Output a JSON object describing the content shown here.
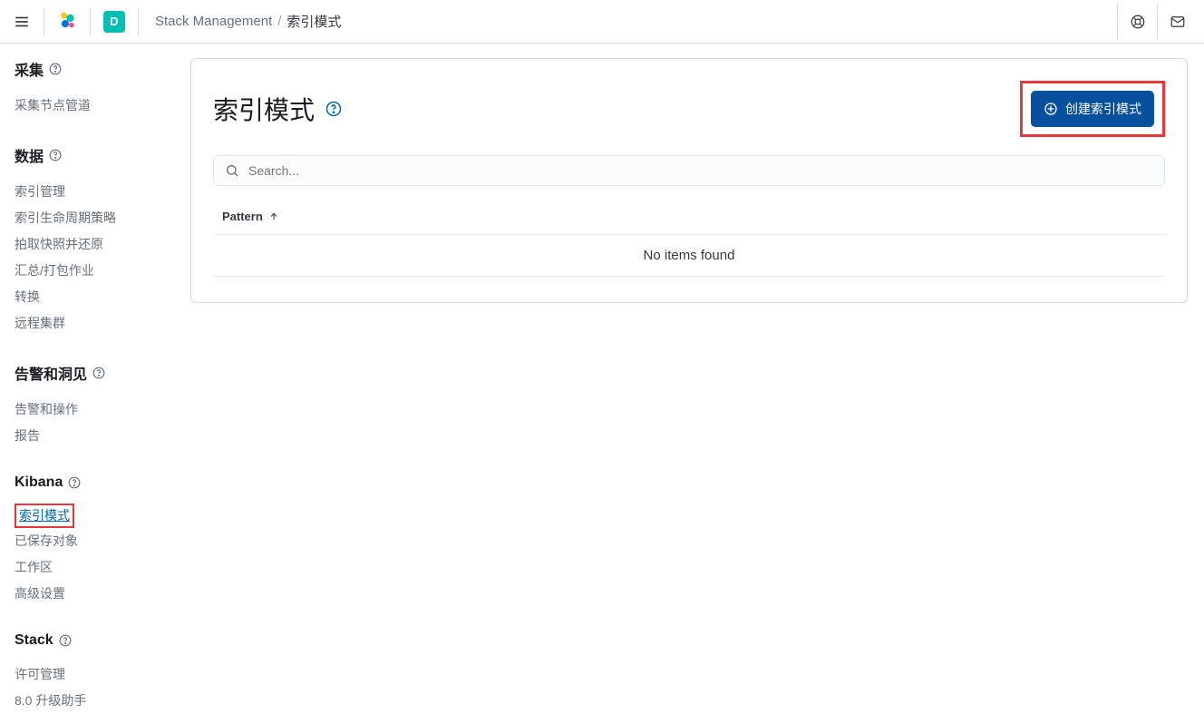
{
  "topbar": {
    "breadcrumb_root": "Stack Management",
    "breadcrumb_sep": "/",
    "breadcrumb_current": "索引模式",
    "space_initial": "D"
  },
  "sidebar": {
    "sections": [
      {
        "title": "采集",
        "items": [
          "采集节点管道"
        ]
      },
      {
        "title": "数据",
        "items": [
          "索引管理",
          "索引生命周期策略",
          "拍取快照并还原",
          "汇总/打包作业",
          "转换",
          "远程集群"
        ]
      },
      {
        "title": "告警和洞见",
        "items": [
          "告警和操作",
          "报告"
        ]
      },
      {
        "title": "Kibana",
        "items": [
          "索引模式",
          "已保存对象",
          "工作区",
          "高级设置"
        ],
        "active_index": 0
      },
      {
        "title": "Stack",
        "items": [
          "许可管理",
          "8.0 升级助手"
        ]
      }
    ]
  },
  "page": {
    "title": "索引模式",
    "create_label": "创建索引模式",
    "search_placeholder": "Search...",
    "column_pattern": "Pattern",
    "empty_text": "No items found"
  }
}
